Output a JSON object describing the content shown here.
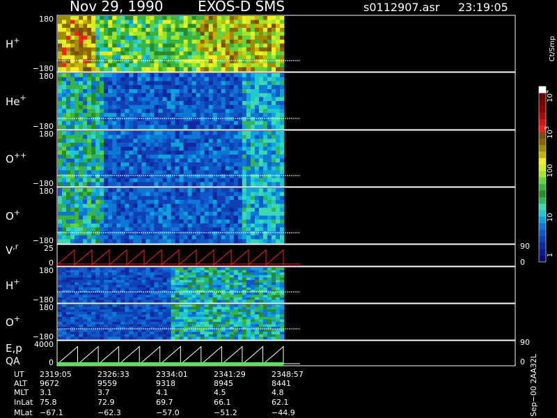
{
  "header": {
    "date": "Nov 29, 1990",
    "instrument": "EXOS-D SMS",
    "file": "s0112907.asr",
    "time": "23:19:05"
  },
  "colorbar": {
    "unit": "Ct/Smp",
    "tick_labels": [
      "1",
      "10",
      "100",
      "10",
      "10"
    ],
    "tick_exponents": [
      "",
      "",
      "",
      "3",
      "4"
    ],
    "colors": [
      "#0b0b78",
      "#0d1a8c",
      "#0f2aa0",
      "#1040b4",
      "#0f5ac8",
      "#0d78d6",
      "#10a0dc",
      "#1ec8d2",
      "#3cd8b4",
      "#32b45a",
      "#288c28",
      "#3cb43c",
      "#64d23c",
      "#a0e628",
      "#d2ec28",
      "#f0f01e",
      "#c8b400",
      "#a08c00",
      "#8c6400",
      "#785014",
      "#ff1e1e",
      "#d21414",
      "#aa0a0a",
      "#8c0000",
      "#780000",
      "#640000",
      "#ffffff"
    ]
  },
  "panels": [
    {
      "species": "H",
      "charge": "+",
      "ymax": "180",
      "ymin": "−180",
      "kind": "spectro"
    },
    {
      "species": "He",
      "charge": "+",
      "ymax": "180",
      "ymin": "−180",
      "kind": "spectro"
    },
    {
      "species": "O",
      "charge": "++",
      "ymax": "180",
      "ymin": "−180",
      "kind": "spectro"
    },
    {
      "species": "O",
      "charge": "+",
      "ymax": "180",
      "ymin": "−180",
      "kind": "spectro"
    },
    {
      "species": "V",
      "charge": ",r",
      "ymax": "25",
      "ymin": "0",
      "kind": "line",
      "right_top": "90",
      "right_bottom": "0"
    },
    {
      "species": "H",
      "charge": "+",
      "ymax": "180",
      "ymin": "−180",
      "kind": "spectro"
    },
    {
      "species": "O",
      "charge": "+",
      "ymax": "180",
      "ymin": "−180",
      "kind": "spectro"
    },
    {
      "species": "E,p",
      "charge": "",
      "ymax": "4000",
      "ymin": "0",
      "kind": "line",
      "label2": "QA",
      "right_top": "90",
      "right_bottom": "0"
    }
  ],
  "orbit_table": {
    "row_labels": [
      "UT",
      "ALT",
      "MLT",
      "InLat",
      "MLat"
    ],
    "columns": [
      [
        "2319:05",
        "9672",
        "3.1",
        "75.8",
        "−67.1"
      ],
      [
        "2326:33",
        "9559",
        "3.7",
        "72.9",
        "−62.3"
      ],
      [
        "2334:01",
        "9318",
        "4.1",
        "69.7",
        "−57.0"
      ],
      [
        "2341:29",
        "8945",
        "4.5",
        "66.1",
        "−51.2"
      ],
      [
        "2348:57",
        "8441",
        "4.8",
        "62.1",
        "−44.9"
      ]
    ]
  },
  "footer_vertical": "Sep−00  2AA32L",
  "chart_data": {
    "type": "heatmap",
    "title": "Nov 29, 1990   EXOS-D SMS",
    "x_tick_labels": [
      "2319:05",
      "2326:33",
      "2334:01",
      "2341:29",
      "2348:57"
    ],
    "series": [
      {
        "name": "H+",
        "y_range": [
          -180,
          180
        ]
      },
      {
        "name": "He+",
        "y_range": [
          -180,
          180
        ]
      },
      {
        "name": "O++",
        "y_range": [
          -180,
          180
        ]
      },
      {
        "name": "O+",
        "y_range": [
          -180,
          180
        ]
      },
      {
        "name": "V,r",
        "y_range": [
          0,
          25
        ]
      },
      {
        "name": "H+",
        "y_range": [
          -180,
          180
        ]
      },
      {
        "name": "O+",
        "y_range": [
          -180,
          180
        ]
      },
      {
        "name": "E,p",
        "y_range": [
          0,
          4000
        ]
      }
    ],
    "colorbar_range": [
      1,
      10000
    ],
    "colorbar_scale": "log"
  }
}
